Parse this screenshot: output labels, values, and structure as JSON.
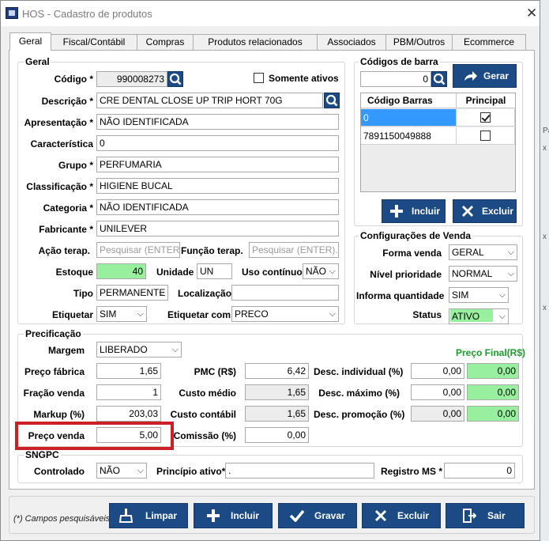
{
  "window": {
    "title": "HOS - Cadastro de produtos",
    "close_glyph": "✕"
  },
  "tabs": [
    "Geral",
    "Fiscal/Contábil",
    "Compras",
    "Produtos relacionados",
    "Associados",
    "PBM/Outros",
    "Ecommerce"
  ],
  "geral": {
    "group_title": "Geral",
    "codigo": {
      "label": "Código *",
      "value": "990008273"
    },
    "somente_ativos": {
      "label": "Somente ativos",
      "checked": false
    },
    "descricao": {
      "label": "Descrição *",
      "value": "CRE DENTAL CLOSE UP TRIP HORT 70G"
    },
    "apresentacao": {
      "label": "Apresentação *",
      "value": "NÃO IDENTIFICADA"
    },
    "caracteristica": {
      "label": "Característica",
      "value": "0"
    },
    "grupo": {
      "label": "Grupo *",
      "value": "PERFUMARIA"
    },
    "classificacao": {
      "label": "Classificação *",
      "value": "HIGIENE BUCAL"
    },
    "categoria": {
      "label": "Categoria *",
      "value": "NÃO IDENTIFICADA"
    },
    "fabricante": {
      "label": "Fabricante *",
      "value": "UNILEVER"
    },
    "acao_terap": {
      "label": "Ação terap.",
      "placeholder": "Pesquisar (ENTER)..."
    },
    "funcao_terap": {
      "label": "Função terap.",
      "placeholder": "Pesquisar (ENTER)..."
    },
    "estoque": {
      "label": "Estoque",
      "value": "40"
    },
    "unidade": {
      "label": "Unidade",
      "value": "UN"
    },
    "uso_continuo": {
      "label": "Uso contínuo",
      "value": "NÃO"
    },
    "tipo": {
      "label": "Tipo",
      "value": "PERMANENTE"
    },
    "localizacao": {
      "label": "Localização",
      "value": ""
    },
    "etiquetar": {
      "label": "Etiquetar",
      "value": "SIM"
    },
    "etiquetar_com": {
      "label": "Etiquetar com",
      "value": "PRECO"
    }
  },
  "barcodes": {
    "group_title": "Códigos de barra",
    "input_value": "0",
    "gerar_label": "Gerar",
    "columns": [
      "Código Barras",
      "Principal"
    ],
    "rows": [
      {
        "code": "0",
        "principal": true
      },
      {
        "code": "7891150049888",
        "principal": false
      }
    ],
    "incluir_label": "Incluir",
    "excluir_label": "Excluir"
  },
  "venda": {
    "group_title": "Configurações de Venda",
    "forma_venda": {
      "label": "Forma venda",
      "value": "GERAL"
    },
    "nivel_prioridade": {
      "label": "Nível prioridade",
      "value": "NORMAL"
    },
    "informa_quantidade": {
      "label": "Informa quantidade",
      "value": "SIM"
    },
    "status": {
      "label": "Status",
      "value": "ATIVO"
    }
  },
  "precificacao": {
    "group_title": "Precificação",
    "margem": {
      "label": "Margem",
      "value": "LIBERADO"
    },
    "preco_final_header": "Preço Final(R$)",
    "preco_fabrica": {
      "label": "Preço fábrica",
      "value": "1,65"
    },
    "fracao_venda": {
      "label": "Fração venda",
      "value": "1"
    },
    "markup": {
      "label": "Markup (%)",
      "value": "203,03"
    },
    "preco_venda": {
      "label": "Preço venda",
      "value": "5,00"
    },
    "pmc": {
      "label": "PMC (R$)",
      "value": "6,42"
    },
    "custo_medio": {
      "label": "Custo médio",
      "value": "1,65"
    },
    "custo_contabil": {
      "label": "Custo contábil",
      "value": "1,65"
    },
    "comissao": {
      "label": "Comissão (%)",
      "value": "0,00"
    },
    "desc_individual": {
      "label": "Desc. individual (%)",
      "value": "0,00",
      "final": "0,00"
    },
    "desc_maximo": {
      "label": "Desc. máximo (%)",
      "value": "0,00",
      "final": "0,00"
    },
    "desc_promocao": {
      "label": "Desc. promoção (%)",
      "value": "0,00",
      "final": "0,00"
    }
  },
  "sngpc": {
    "group_title": "SNGPC",
    "controlado": {
      "label": "Controlado",
      "value": "NÃO"
    },
    "principio_ativo": {
      "label": "Princípio ativo*",
      "value": "."
    },
    "registro_ms": {
      "label": "Registro MS *",
      "value": "0"
    }
  },
  "footer": {
    "note": "(*) Campos pesquisáveis",
    "buttons": [
      "Limpar",
      "Incluir",
      "Gravar",
      "Excluir",
      "Sair"
    ]
  },
  "colors": {
    "accent": "#1b4a84",
    "green_field": "#98f09e",
    "highlight_box": "#cc1f26",
    "preco_final": "#1a9c2a",
    "grid_selection": "#3399ff"
  }
}
